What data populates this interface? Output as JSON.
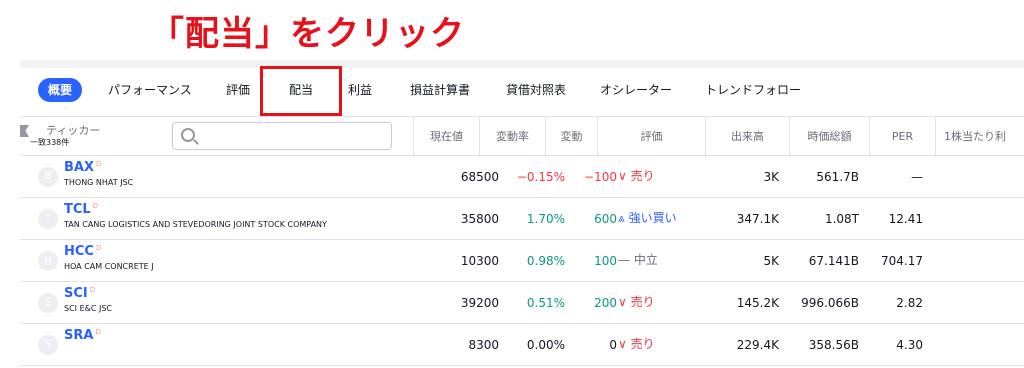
{
  "headline": "「配当」をクリック",
  "tabs": [
    {
      "label": "概要",
      "active": true
    },
    {
      "label": "パフォーマンス",
      "active": false
    },
    {
      "label": "評価",
      "active": false
    },
    {
      "label": "配当",
      "active": false,
      "highlighted": true
    },
    {
      "label": "利益",
      "active": false
    },
    {
      "label": "損益計算書",
      "active": false
    },
    {
      "label": "貸借対照表",
      "active": false
    },
    {
      "label": "オシレーター",
      "active": false
    },
    {
      "label": "トレンドフォロー",
      "active": false
    }
  ],
  "table": {
    "ticker_header": "ティッカー",
    "match_count": "一致338件",
    "search_placeholder": "",
    "columns": [
      "現在値",
      "変動率",
      "変動",
      "評価",
      "出来高",
      "時価総額",
      "PER",
      "1株当たり利"
    ],
    "rows": [
      {
        "symbol": "BAX",
        "badge": "D",
        "name": "THONG NHAT JSC",
        "logo": "B",
        "price": "68500",
        "change_pct": "−0.15%",
        "change": "−100",
        "direction": "neg",
        "rating": "∨ 売り",
        "rating_type": "sell",
        "volume": "3K",
        "mcap": "561.7B",
        "per": "—"
      },
      {
        "symbol": "TCL",
        "badge": "D",
        "name": "TAN CANG LOGISTICS AND STEVEDORING JOINT STOCK COMPANY",
        "logo": "T",
        "price": "35800",
        "change_pct": "1.70%",
        "change": "600",
        "direction": "pos",
        "rating": "⩓ 強い買い",
        "rating_type": "buy",
        "volume": "347.1K",
        "mcap": "1.08T",
        "per": "12.41"
      },
      {
        "symbol": "HCC",
        "badge": "D",
        "name": "HOA CAM CONCRETE J",
        "logo": "H",
        "price": "10300",
        "change_pct": "0.98%",
        "change": "100",
        "direction": "pos",
        "rating": "— 中立",
        "rating_type": "neutral",
        "volume": "5K",
        "mcap": "67.141B",
        "per": "704.17"
      },
      {
        "symbol": "SCI",
        "badge": "D",
        "name": "SCI E&C JSC",
        "logo": "S",
        "price": "39200",
        "change_pct": "0.51%",
        "change": "200",
        "direction": "pos",
        "rating": "∨ 売り",
        "rating_type": "sell",
        "volume": "145.2K",
        "mcap": "996.066B",
        "per": "2.82"
      },
      {
        "symbol": "SRA",
        "badge": "D",
        "name": "",
        "logo": "S",
        "price": "8300",
        "change_pct": "0.00%",
        "change": "0",
        "direction": "neu",
        "rating": "∨ 売り",
        "rating_type": "sell",
        "volume": "229.4K",
        "mcap": "358.56B",
        "per": "4.30"
      }
    ]
  },
  "colors": {
    "accent": "#2962ff",
    "highlight": "#e8101a",
    "positive": "#089981",
    "negative": "#f23645"
  }
}
